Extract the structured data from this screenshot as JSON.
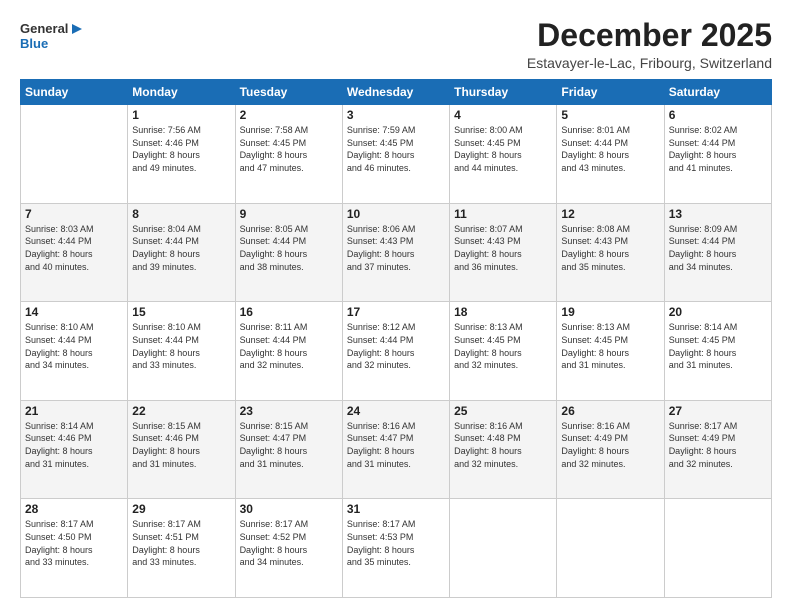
{
  "logo": {
    "line1": "General",
    "line2": "Blue"
  },
  "title": "December 2025",
  "location": "Estavayer-le-Lac, Fribourg, Switzerland",
  "days_of_week": [
    "Sunday",
    "Monday",
    "Tuesday",
    "Wednesday",
    "Thursday",
    "Friday",
    "Saturday"
  ],
  "weeks": [
    [
      {
        "day": "",
        "info": ""
      },
      {
        "day": "1",
        "info": "Sunrise: 7:56 AM\nSunset: 4:46 PM\nDaylight: 8 hours\nand 49 minutes."
      },
      {
        "day": "2",
        "info": "Sunrise: 7:58 AM\nSunset: 4:45 PM\nDaylight: 8 hours\nand 47 minutes."
      },
      {
        "day": "3",
        "info": "Sunrise: 7:59 AM\nSunset: 4:45 PM\nDaylight: 8 hours\nand 46 minutes."
      },
      {
        "day": "4",
        "info": "Sunrise: 8:00 AM\nSunset: 4:45 PM\nDaylight: 8 hours\nand 44 minutes."
      },
      {
        "day": "5",
        "info": "Sunrise: 8:01 AM\nSunset: 4:44 PM\nDaylight: 8 hours\nand 43 minutes."
      },
      {
        "day": "6",
        "info": "Sunrise: 8:02 AM\nSunset: 4:44 PM\nDaylight: 8 hours\nand 41 minutes."
      }
    ],
    [
      {
        "day": "7",
        "info": "Sunrise: 8:03 AM\nSunset: 4:44 PM\nDaylight: 8 hours\nand 40 minutes."
      },
      {
        "day": "8",
        "info": "Sunrise: 8:04 AM\nSunset: 4:44 PM\nDaylight: 8 hours\nand 39 minutes."
      },
      {
        "day": "9",
        "info": "Sunrise: 8:05 AM\nSunset: 4:44 PM\nDaylight: 8 hours\nand 38 minutes."
      },
      {
        "day": "10",
        "info": "Sunrise: 8:06 AM\nSunset: 4:43 PM\nDaylight: 8 hours\nand 37 minutes."
      },
      {
        "day": "11",
        "info": "Sunrise: 8:07 AM\nSunset: 4:43 PM\nDaylight: 8 hours\nand 36 minutes."
      },
      {
        "day": "12",
        "info": "Sunrise: 8:08 AM\nSunset: 4:43 PM\nDaylight: 8 hours\nand 35 minutes."
      },
      {
        "day": "13",
        "info": "Sunrise: 8:09 AM\nSunset: 4:44 PM\nDaylight: 8 hours\nand 34 minutes."
      }
    ],
    [
      {
        "day": "14",
        "info": "Sunrise: 8:10 AM\nSunset: 4:44 PM\nDaylight: 8 hours\nand 34 minutes."
      },
      {
        "day": "15",
        "info": "Sunrise: 8:10 AM\nSunset: 4:44 PM\nDaylight: 8 hours\nand 33 minutes."
      },
      {
        "day": "16",
        "info": "Sunrise: 8:11 AM\nSunset: 4:44 PM\nDaylight: 8 hours\nand 32 minutes."
      },
      {
        "day": "17",
        "info": "Sunrise: 8:12 AM\nSunset: 4:44 PM\nDaylight: 8 hours\nand 32 minutes."
      },
      {
        "day": "18",
        "info": "Sunrise: 8:13 AM\nSunset: 4:45 PM\nDaylight: 8 hours\nand 32 minutes."
      },
      {
        "day": "19",
        "info": "Sunrise: 8:13 AM\nSunset: 4:45 PM\nDaylight: 8 hours\nand 31 minutes."
      },
      {
        "day": "20",
        "info": "Sunrise: 8:14 AM\nSunset: 4:45 PM\nDaylight: 8 hours\nand 31 minutes."
      }
    ],
    [
      {
        "day": "21",
        "info": "Sunrise: 8:14 AM\nSunset: 4:46 PM\nDaylight: 8 hours\nand 31 minutes."
      },
      {
        "day": "22",
        "info": "Sunrise: 8:15 AM\nSunset: 4:46 PM\nDaylight: 8 hours\nand 31 minutes."
      },
      {
        "day": "23",
        "info": "Sunrise: 8:15 AM\nSunset: 4:47 PM\nDaylight: 8 hours\nand 31 minutes."
      },
      {
        "day": "24",
        "info": "Sunrise: 8:16 AM\nSunset: 4:47 PM\nDaylight: 8 hours\nand 31 minutes."
      },
      {
        "day": "25",
        "info": "Sunrise: 8:16 AM\nSunset: 4:48 PM\nDaylight: 8 hours\nand 32 minutes."
      },
      {
        "day": "26",
        "info": "Sunrise: 8:16 AM\nSunset: 4:49 PM\nDaylight: 8 hours\nand 32 minutes."
      },
      {
        "day": "27",
        "info": "Sunrise: 8:17 AM\nSunset: 4:49 PM\nDaylight: 8 hours\nand 32 minutes."
      }
    ],
    [
      {
        "day": "28",
        "info": "Sunrise: 8:17 AM\nSunset: 4:50 PM\nDaylight: 8 hours\nand 33 minutes."
      },
      {
        "day": "29",
        "info": "Sunrise: 8:17 AM\nSunset: 4:51 PM\nDaylight: 8 hours\nand 33 minutes."
      },
      {
        "day": "30",
        "info": "Sunrise: 8:17 AM\nSunset: 4:52 PM\nDaylight: 8 hours\nand 34 minutes."
      },
      {
        "day": "31",
        "info": "Sunrise: 8:17 AM\nSunset: 4:53 PM\nDaylight: 8 hours\nand 35 minutes."
      },
      {
        "day": "",
        "info": ""
      },
      {
        "day": "",
        "info": ""
      },
      {
        "day": "",
        "info": ""
      }
    ]
  ]
}
